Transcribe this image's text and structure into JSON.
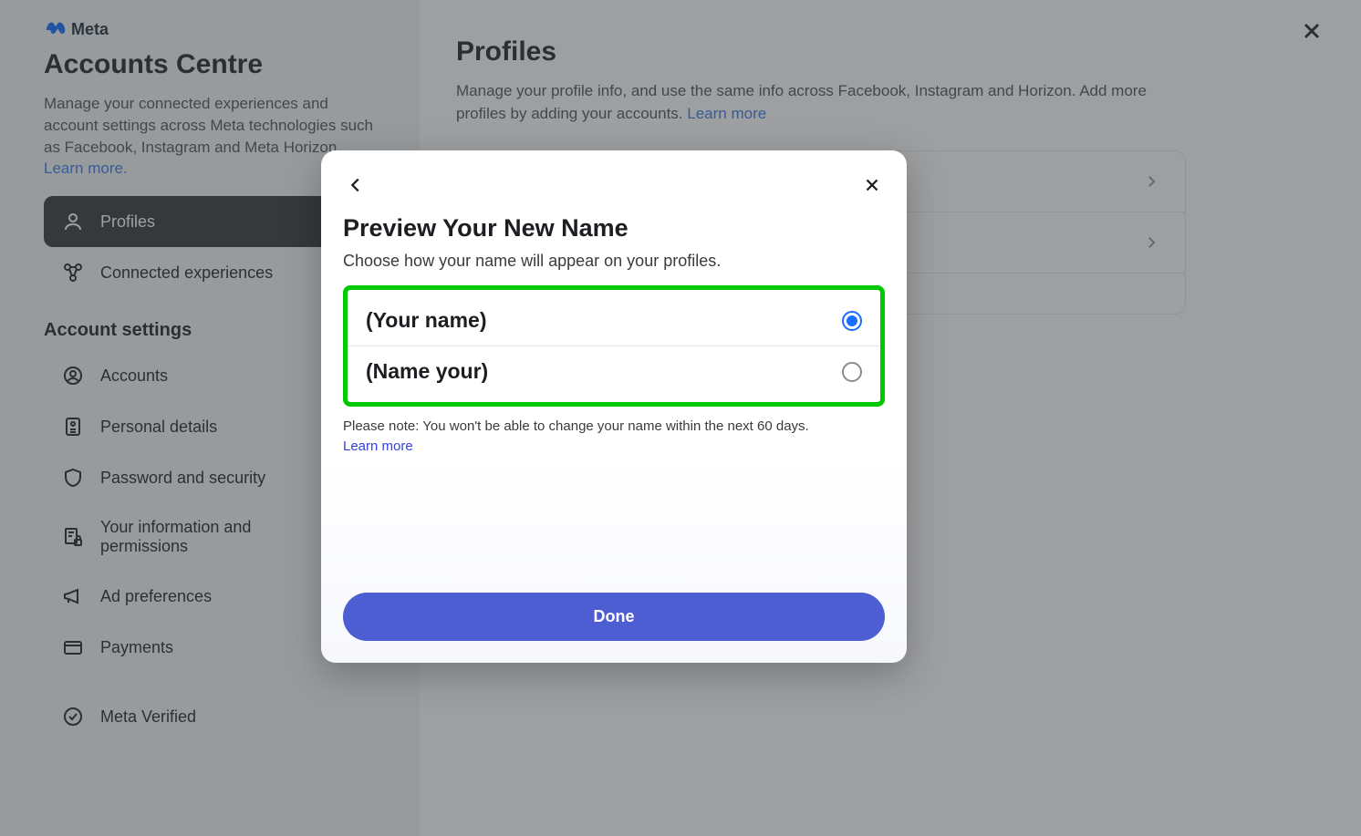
{
  "brand": {
    "name": "Meta"
  },
  "sidebar": {
    "title": "Accounts Centre",
    "description": "Manage your connected experiences and account settings across Meta technologies such as Facebook, Instagram and Meta Horizon. ",
    "learn_more": "Learn more.",
    "nav": [
      {
        "label": "Profiles"
      },
      {
        "label": "Connected experiences"
      }
    ],
    "section_title": "Account settings",
    "settings": [
      {
        "label": "Accounts"
      },
      {
        "label": "Personal details"
      },
      {
        "label": "Password and security"
      },
      {
        "label": "Your information and permissions"
      },
      {
        "label": "Ad preferences"
      },
      {
        "label": "Payments"
      },
      {
        "label": "Meta Verified"
      }
    ]
  },
  "main": {
    "title": "Profiles",
    "description": "Manage your profile info, and use the same info across Facebook, Instagram and Horizon. Add more profiles by adding your accounts. ",
    "learn_more": "Learn more"
  },
  "modal": {
    "title": "Preview Your New Name",
    "subtitle": "Choose how your name will appear on your profiles.",
    "options": [
      {
        "label": "(Your name)",
        "selected": true
      },
      {
        "label": "(Name your)",
        "selected": false
      }
    ],
    "note": "Please note: You won't be able to change your name within the next 60 days.",
    "note_link": "Learn more",
    "done_label": "Done"
  }
}
